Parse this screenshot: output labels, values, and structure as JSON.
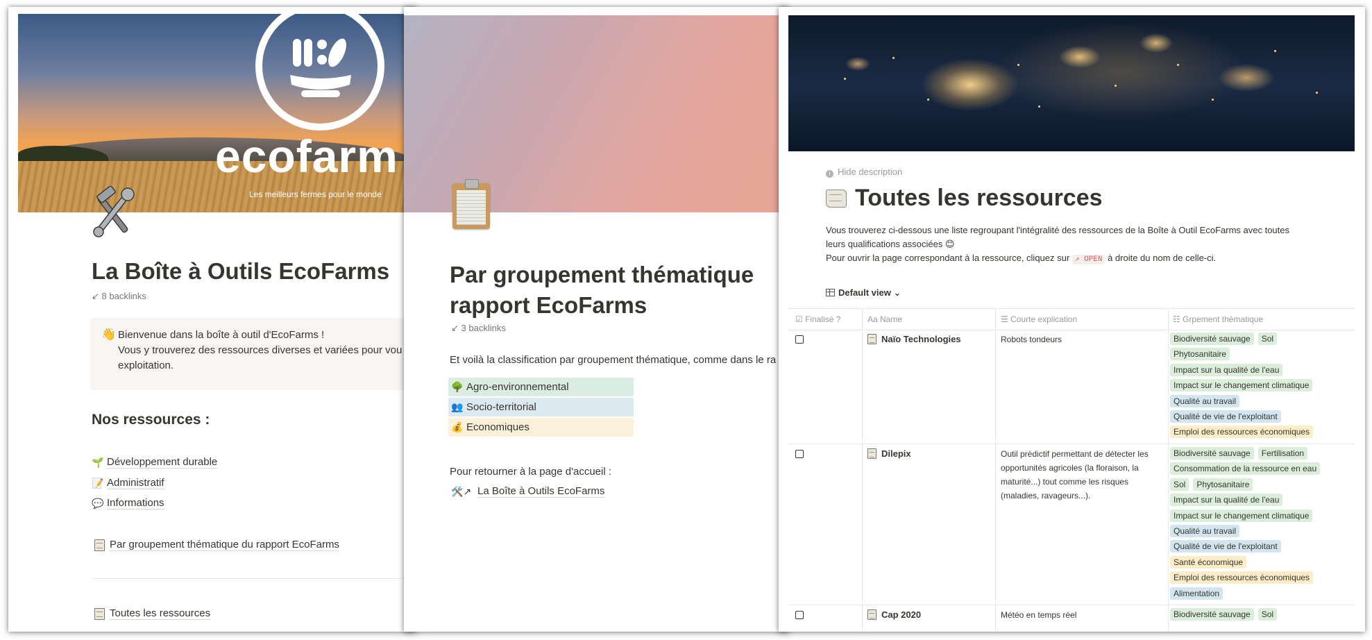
{
  "panel1": {
    "brand": "ecofarm",
    "tagline": "Les meilleurs fermes pour le monde",
    "title": "La Boîte à Outils EcoFarms",
    "backlinks": "8 backlinks",
    "callout_line1": "Bienvenue dans la boîte à outil d'EcoFarms !",
    "callout_line2": "Vous y trouverez des ressources diverses et variées pour vou",
    "callout_line3": "exploitation.",
    "heading": "Nos ressources :",
    "links": [
      {
        "icon": "🌱",
        "label": "Développement durable"
      },
      {
        "icon": "📝",
        "label": "Administratif"
      },
      {
        "icon": "💬",
        "label": "Informations"
      }
    ],
    "grouping_link": "Par groupement thématique du rapport EcoFarms",
    "all_resources_link": "Toutes les ressources"
  },
  "panel2": {
    "title_line1": "Par groupement thématique",
    "title_line2": "rapport EcoFarms",
    "backlinks": "3 backlinks",
    "intro": "Et voilà la classification par groupement thématique, comme dans le ra",
    "categories": [
      {
        "icon": "🌳",
        "label": "Agro-environnemental",
        "color": "#dbece2"
      },
      {
        "icon": "👥",
        "label": "Socio-territorial",
        "color": "#dde9f0"
      },
      {
        "icon": "💰",
        "label": "Economiques",
        "color": "#fbf0d9"
      }
    ],
    "return_text": "Pour retourner à la page d'accueil :",
    "return_link": "La Boîte à Outils EcoFarms"
  },
  "panel3": {
    "hide_description": "Hide description",
    "title": "Toutes les ressources",
    "desc_line1": "Vous trouverez ci-dessous une liste regroupant l'intégralité des ressources de la Boîte à Outil EcoFarms avec toutes",
    "desc_line2": "leurs qualifications associées 😊",
    "desc_line3_before": "Pour ouvrir la page correspondant à la ressource, cliquez sur",
    "open_label": "↗ OPEN",
    "desc_line3_after": "à droite du nom de celle-ci.",
    "view": "Default view",
    "columns": [
      "Finalisé ?",
      "Name",
      "Courte explication",
      "Grpement thématique"
    ],
    "rows": [
      {
        "name": "Naïo Technologies",
        "desc": "Robots tondeurs",
        "tag_lines": [
          [
            {
              "t": "Biodiversité sauvage",
              "c": "g"
            },
            {
              "t": "Sol",
              "c": "g"
            }
          ],
          [
            {
              "t": "Phytosanitaire",
              "c": "g"
            }
          ],
          [
            {
              "t": "Impact sur la qualité de l'eau",
              "c": "g"
            }
          ],
          [
            {
              "t": "Impact sur le changement climatique",
              "c": "g"
            }
          ],
          [
            {
              "t": "Qualité au travail",
              "c": "b"
            }
          ],
          [
            {
              "t": "Qualité de vie de l'exploitant",
              "c": "b"
            }
          ],
          [
            {
              "t": "Emploi des ressources économiques",
              "c": "o"
            }
          ]
        ]
      },
      {
        "name": "Dilepix",
        "desc": "Outil prédictif permettant de détecter les opportunités agricoles (la floraison, la maturité...) tout comme les risques (maladies, ravageurs...).",
        "tag_lines": [
          [
            {
              "t": "Biodiversité sauvage",
              "c": "g"
            },
            {
              "t": "Fertilisation",
              "c": "g"
            }
          ],
          [
            {
              "t": "Consommation de la ressource en eau",
              "c": "g"
            }
          ],
          [
            {
              "t": "Sol",
              "c": "g"
            },
            {
              "t": "Phytosanitaire",
              "c": "g"
            }
          ],
          [
            {
              "t": "Impact sur la qualité de l'eau",
              "c": "g"
            }
          ],
          [
            {
              "t": "Impact sur le changement climatique",
              "c": "g"
            }
          ],
          [
            {
              "t": "Qualité au travail",
              "c": "b"
            }
          ],
          [
            {
              "t": "Qualité de vie de l'exploitant",
              "c": "b"
            }
          ],
          [
            {
              "t": "Santé économique",
              "c": "o"
            }
          ],
          [
            {
              "t": "Emploi des ressources économiques",
              "c": "o"
            }
          ],
          [
            {
              "t": "Alimentation",
              "c": "b"
            }
          ]
        ]
      },
      {
        "name": "Cap 2020",
        "desc": "Météo en temps réel",
        "tag_lines": [
          [
            {
              "t": "Biodiversité sauvage",
              "c": "g"
            },
            {
              "t": "Sol",
              "c": "g"
            }
          ]
        ]
      }
    ]
  }
}
